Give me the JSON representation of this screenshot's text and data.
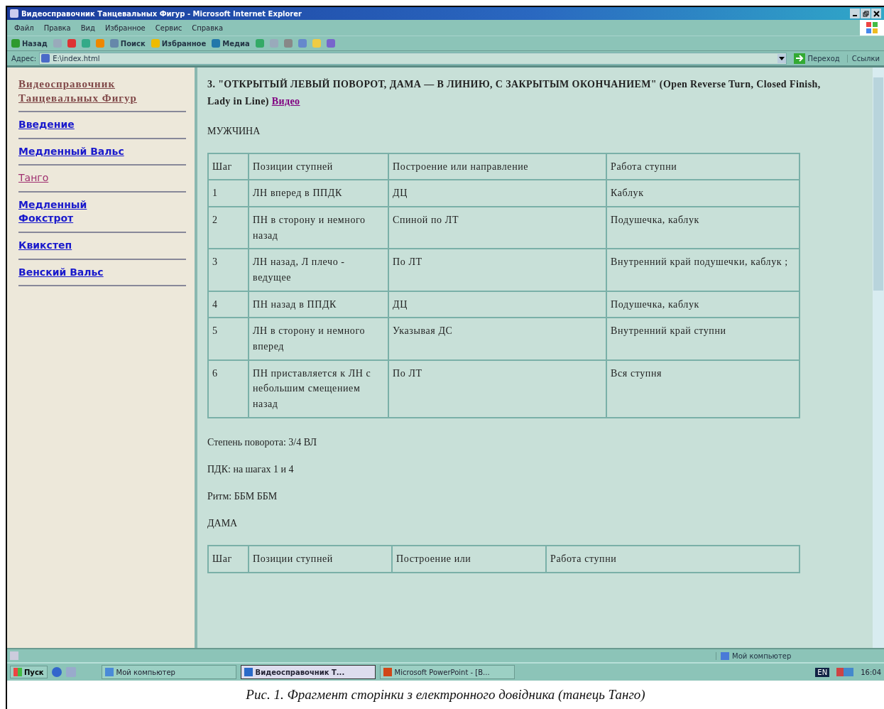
{
  "window": {
    "title": "Видеосправочник Танцевальных Фигур - Microsoft Internet Explorer"
  },
  "menu": [
    "Файл",
    "Правка",
    "Вид",
    "Избранное",
    "Сервис",
    "Справка"
  ],
  "toolbar": [
    {
      "kind": "back",
      "label": "Назад"
    },
    {
      "kind": "forward"
    },
    {
      "kind": "stop"
    },
    {
      "kind": "refresh"
    },
    {
      "kind": "home"
    },
    {
      "kind": "search",
      "label": "Поиск"
    },
    {
      "kind": "favorites",
      "label": "Избранное"
    },
    {
      "kind": "media",
      "label": "Медиа"
    },
    {
      "kind": "history"
    },
    {
      "kind": "mail"
    },
    {
      "kind": "print"
    },
    {
      "kind": "edit"
    },
    {
      "kind": "folder"
    },
    {
      "kind": "messenger"
    }
  ],
  "address": {
    "label": "Адрес:",
    "value": "E:\\index.html",
    "go": "Переход",
    "links": "Ссылки"
  },
  "sidebar": {
    "title": "Видеосправочник Танцевальных Фигур",
    "items": [
      {
        "label": "Введение",
        "selected": false
      },
      {
        "label": "Медленный Вальс",
        "selected": false
      },
      {
        "label": "Танго",
        "selected": true
      },
      {
        "label": "Медленный Фокстрот",
        "selected": false
      },
      {
        "label": "Квикстеп",
        "selected": false
      },
      {
        "label": "Венский Вальс",
        "selected": false
      }
    ]
  },
  "content": {
    "heading": "3.   \"ОТКРЫТЫЙ ЛЕВЫЙ ПОВОРОТ, ДАМА — В ЛИНИЮ, С ЗАКРЫТЫМ ОКОНЧАНИЕМ\" (Open Reverse Turn, Closed Finish, Lady in Line)",
    "video_link": "Видео",
    "man": {
      "title": "МУЖЧИНА",
      "columns": [
        "Шаг",
        "Позиции ступней",
        "Построение или направление",
        "Работа ступни"
      ],
      "rows": [
        [
          "1",
          "ЛН вперед в ППДК",
          "ДЦ",
          "Каблук"
        ],
        [
          "2",
          "ПН в сторону и немного назад",
          "Спиной по ЛТ",
          "Подушечка, каблук"
        ],
        [
          "3",
          "ЛН назад, Л плечо - ведущее",
          "По ЛТ",
          "Внутренний край подушечки, каблук ;"
        ],
        [
          "4",
          "ПН назад в ППДК",
          "ДЦ",
          "Подушечка, каблук"
        ],
        [
          "5",
          "ЛН в сторону и немного вперед",
          "Указывая ДС",
          "Внутренний край ступни"
        ],
        [
          "6",
          "ПН приставляется к ЛН с небольшим смещением назад",
          "По ЛТ",
          "Вся ступня"
        ]
      ]
    },
    "notes": [
      "Степень поворота:  3/4 ВЛ",
      "ПДК:   на шагах 1 и 4",
      "Ритм:   ББМ ББМ"
    ],
    "lady": {
      "title": "ДАМА",
      "columns": [
        "Шаг",
        "Позиции ступней",
        "Построение или",
        "Работа ступни"
      ]
    }
  },
  "status_bar": {
    "zone": "Мой компьютер"
  },
  "taskbar": {
    "start": "Пуск",
    "tasks": [
      {
        "label": "Мой компьютер",
        "kind": "folder",
        "selected": false
      },
      {
        "label": "Видеосправочник Т...",
        "kind": "browser",
        "selected": true
      },
      {
        "label": "Microsoft PowerPoint - [В...",
        "kind": "powerpoint",
        "selected": false
      }
    ],
    "language": "EN",
    "clock": "16:04"
  },
  "caption": "Рис. 1. Фрагмент сторінки з електронного довідника (танець Танго)"
}
